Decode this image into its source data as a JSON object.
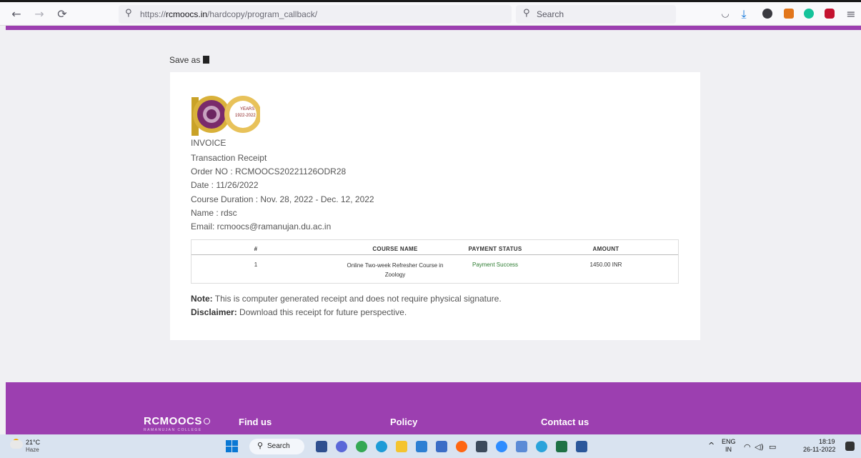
{
  "browser": {
    "url_scheme": "https://",
    "url_host": "rcmoocs.in",
    "url_path": "/hardcopy/program_callback/",
    "search_placeholder": "Search",
    "back_glyph": "←",
    "forward_glyph": "→",
    "reload_glyph": "⟳",
    "search_glyph": "⚲",
    "menu_glyph": "≡",
    "download_glyph": "⤓",
    "pocket_glyph": "◡"
  },
  "page": {
    "save_as_label": "Save as"
  },
  "invoice": {
    "logo_years_label": "YEARS",
    "logo_years_range": "1922-2022",
    "heading": "INVOICE",
    "subheading": "Transaction Receipt",
    "order_no": "Order NO : RCMOOCS20221126ODR28",
    "date": "Date : 11/26/2022",
    "course_duration": "Course Duration : Nov. 28, 2022 - Dec. 12, 2022",
    "name": "Name : rdsc",
    "email": "Email: rcmoocs@ramanujan.du.ac.in",
    "table": {
      "headers": [
        "#",
        "COURSE NAME",
        "PAYMENT STATUS",
        "AMOUNT"
      ],
      "rows": [
        {
          "index": "1",
          "course_line1": "Online Two-week Refresher Course in",
          "course_line2": "Zoology",
          "status": "Payment Success",
          "amount": "1450.00 INR"
        }
      ]
    },
    "note_label": "Note:",
    "note_text": "This is computer generated receipt and does not require physical signature.",
    "disclaimer_label": "Disclaimer:",
    "disclaimer_text": "Download this receipt for future perspective."
  },
  "footer": {
    "brand": "RCMOOCS",
    "brand_sub": "RAMANUJAN COLLEGE",
    "links": [
      "Find us",
      "Policy",
      "Contact us"
    ]
  },
  "taskbar": {
    "temperature": "21°C",
    "weather": "Haze",
    "search_label": "Search",
    "lang_line1": "ENG",
    "lang_line2": "IN",
    "time": "18:19",
    "date": "26-11-2022",
    "tray_chevron": "^",
    "wifi_glyph": "◠",
    "volume_glyph": "◁)",
    "battery_glyph": "▭"
  },
  "colors": {
    "brand_purple": "#9c3fb0",
    "success_green": "#2e7d32"
  }
}
